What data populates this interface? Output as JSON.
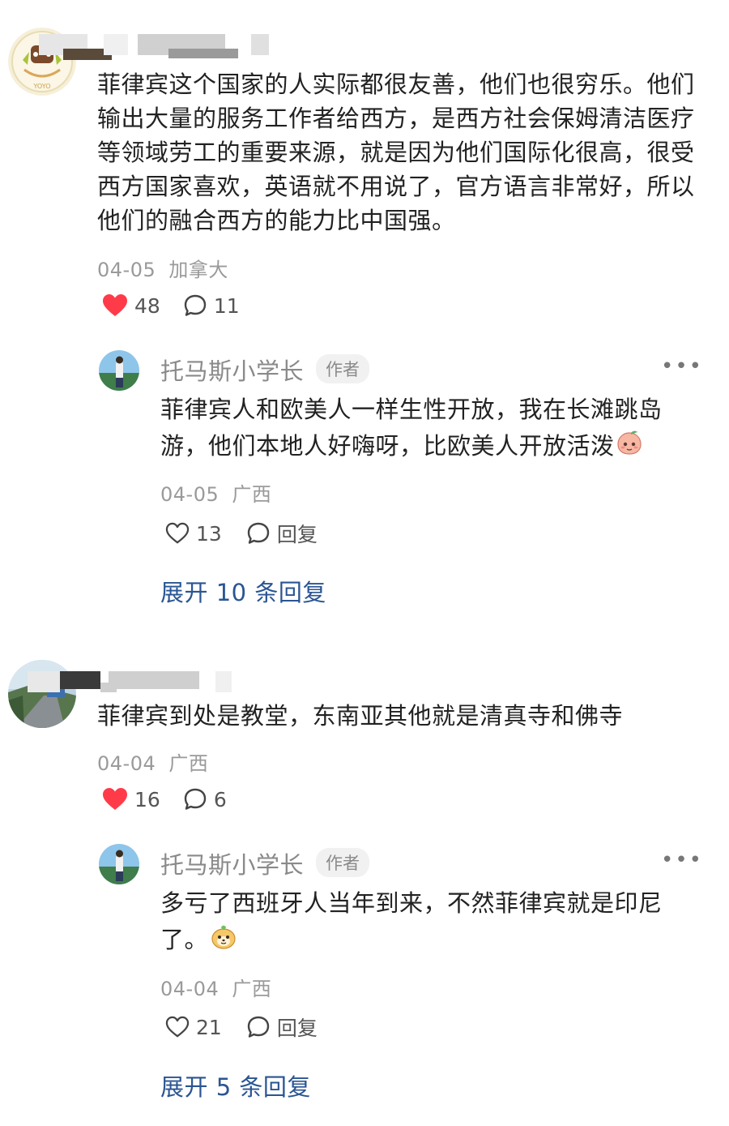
{
  "comments": [
    {
      "content": "菲律宾这个国家的人实际都很友善，他们也很穷乐。他们输出大量的服务工作者给西方，是西方社会保姆清洁医疗等领域劳工的重要来源，就是因为他们国际化很高，很受西方国家喜欢，英语就不用说了，官方语言非常好，所以他们的融合西方的能力比中国强。",
      "avatar_badge_text": "YOYO",
      "date": "04-05",
      "location": "加拿大",
      "likes": "48",
      "replies_count": "11",
      "reply": {
        "name": "托马斯小学长",
        "badge": "作者",
        "content": "菲律宾人和欧美人一样生性开放，我在长滩跳岛游，他们本地人好嗨呀，比欧美人开放活泼",
        "date": "04-05",
        "location": "广西",
        "likes": "13",
        "reply_label": "回复",
        "expand_label": "展开 10 条回复"
      }
    },
    {
      "content": "菲律宾到处是教堂，东南亚其他就是清真寺和佛寺",
      "date": "04-04",
      "location": "广西",
      "likes": "16",
      "replies_count": "6",
      "reply": {
        "name": "托马斯小学长",
        "badge": "作者",
        "content": "多亏了西班牙人当年到来，不然菲律宾就是印尼了。",
        "date": "04-04",
        "location": "广西",
        "likes": "21",
        "reply_label": "回复",
        "expand_label": "展开 5 条回复"
      }
    }
  ],
  "colors": {
    "like_red": "#ff3b4a",
    "link_blue": "#2a5592",
    "meta_gray": "#9a9a9a"
  }
}
